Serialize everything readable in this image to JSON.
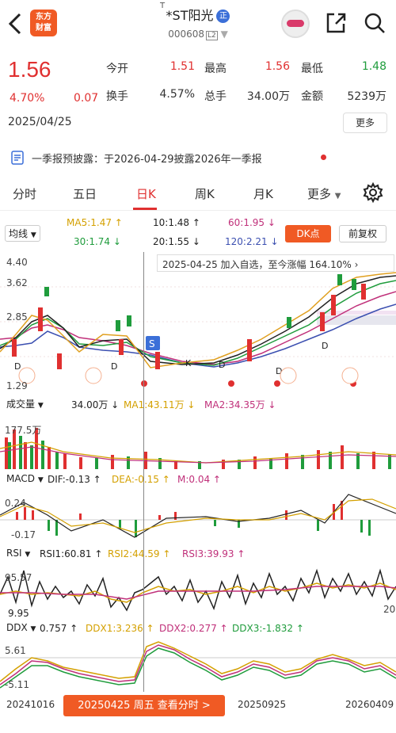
{
  "header": {
    "logo_line1": "东方",
    "logo_line2": "财富",
    "stock_name": "*ST阳光",
    "zheng_badge": "正",
    "stock_code": "000608",
    "level_badge": "L2",
    "t_mark": "T"
  },
  "quote": {
    "price": "1.56",
    "pct": "4.70%",
    "change": "0.07",
    "date": "2025/04/25",
    "open_label": "今开",
    "open": "1.51",
    "high_label": "最高",
    "high": "1.56",
    "low_label": "最低",
    "low": "1.48",
    "turnover_label": "换手",
    "turnover": "4.57%",
    "volume_label": "总手",
    "volume": "34.00万",
    "amount_label": "金额",
    "amount": "5239万",
    "more": "更多"
  },
  "notice": {
    "text": "一季报预披露：于2026-04-29披露2026年一季报"
  },
  "tabs": {
    "t1": "分时",
    "t2": "五日",
    "t3": "日K",
    "t4": "周K",
    "t5": "月K",
    "t6": "更多"
  },
  "ma": {
    "selector": "均线",
    "ma5": "MA5:1.47 ↑",
    "p10": "10:1.48 ↑",
    "p60": "60:1.95 ↓",
    "ma30": "30:1.74 ↓",
    "p20": "20:1.55 ↓",
    "p120": "120:2.21 ↓",
    "dk": "DK点",
    "fq": "前复权"
  },
  "kline": {
    "y_top": "4.40",
    "y_2": "3.62",
    "y_3": "2.85",
    "y_bottom": "1.29",
    "tip": "2025-04-25 加入自选，至今涨幅 164.10%"
  },
  "vol": {
    "selector": "成交量",
    "val": "34.00万 ↓",
    "ma1": "MA1:43.11万 ↓",
    "ma2": "MA2:34.35万 ↓",
    "y_top": "177.5万"
  },
  "macd": {
    "selector": "MACD",
    "dif": "DIF:-0.13 ↑",
    "dea": "DEA:-0.15 ↑",
    "m": "M:0.04 ↑",
    "y_top": "0.24",
    "y_bottom": "-0.17"
  },
  "rsi": {
    "selector": "RSI",
    "rsi1": "RSI1:60.81 ↑",
    "rsi2": "RSI2:44.59 ↑",
    "rsi3": "RSI3:39.93 ↑",
    "y_top": "95.57",
    "y_bottom": "9.95",
    "y_right": "20"
  },
  "ddx": {
    "selector": "DDX",
    "val": "0.757 ↑",
    "ddx1": "DDX1:3.236 ↑",
    "ddx2": "DDX2:0.277 ↑",
    "ddx3": "DDX3:-1.832 ↑",
    "y_top": "5.61",
    "y_bottom": "-5.11"
  },
  "xaxis": {
    "d1": "20241016",
    "d2": "20250925",
    "d3": "20260409",
    "button": "20250425 周五 查看分时 >"
  },
  "colors": {
    "up": "#e03030",
    "down": "#1f9c3c",
    "accent": "#f05a24"
  }
}
